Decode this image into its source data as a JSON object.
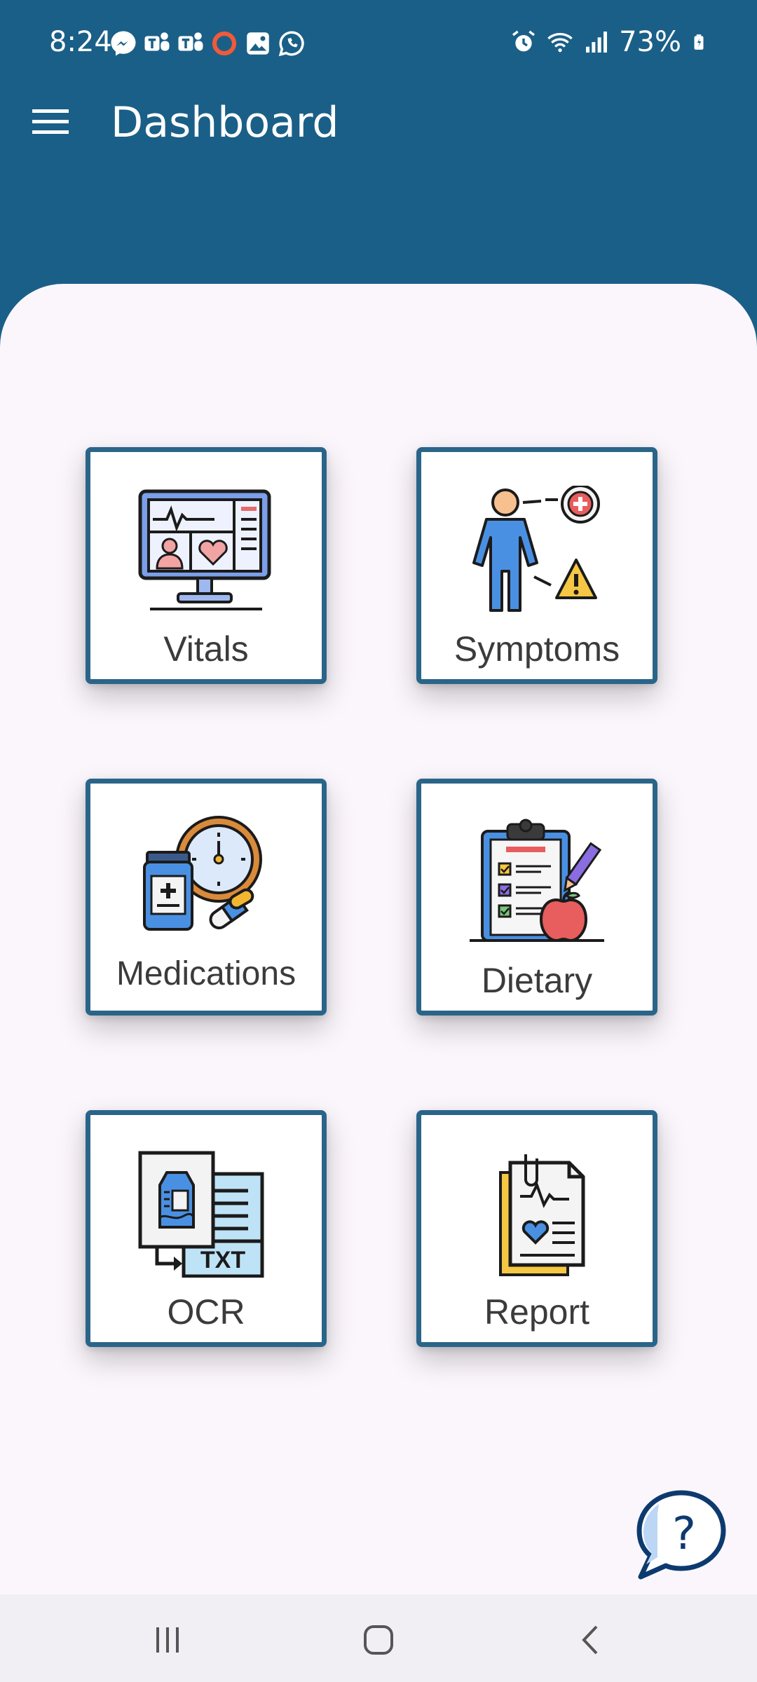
{
  "status_bar": {
    "time": "8:24",
    "battery": "73%",
    "notification_icons": [
      "messenger-icon",
      "teams-icon",
      "teams-icon",
      "circle-app-icon",
      "gallery-icon",
      "whatsapp-icon"
    ],
    "right_icons": [
      "alarm-icon",
      "wifi-icon",
      "signal-icon",
      "battery-icon"
    ]
  },
  "app_bar": {
    "title": "Dashboard",
    "menu_icon": "hamburger-menu-icon"
  },
  "tiles": [
    {
      "label": "Vitals",
      "icon": "vitals-monitor-icon"
    },
    {
      "label": "Symptoms",
      "icon": "symptoms-person-icon"
    },
    {
      "label": "Medications",
      "icon": "medication-clock-icon"
    },
    {
      "label": "Dietary",
      "icon": "diet-clipboard-icon"
    },
    {
      "label": "OCR",
      "icon": "ocr-document-icon"
    },
    {
      "label": "Report",
      "icon": "health-report-icon"
    }
  ],
  "help": {
    "icon": "help-chat-icon",
    "glyph": "?"
  },
  "nav_bar": {
    "buttons": [
      "recent-apps-icon",
      "home-icon",
      "back-icon"
    ]
  },
  "colors": {
    "primary": "#1a5f87",
    "card_border": "#2a6589",
    "sheet_background": "#fbf6fc",
    "label_text": "#3b3b3b"
  }
}
